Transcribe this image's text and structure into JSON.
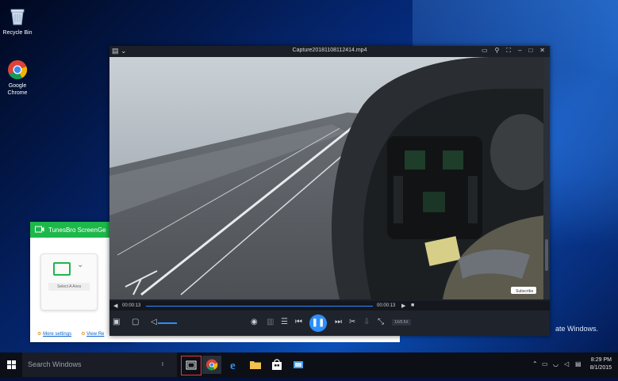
{
  "desktop": {
    "icons": [
      {
        "label": "Recycle Bin"
      },
      {
        "label": "Google Chrome"
      }
    ],
    "watermark": "ate Windows."
  },
  "recorder": {
    "title": "TunesBro ScreenGe",
    "select_area_label": "Select A Area",
    "more_settings": "More settings",
    "view_recordings": "View Re"
  },
  "player": {
    "filename": "Capture20181108112414.mp4",
    "time_current": "00:00:13",
    "time_total": "00:00:13",
    "progress": 1.0,
    "speed_label": "1X/0.5X",
    "watermark_text": "Subscribe",
    "accent": "#2b8fff"
  },
  "taskbar": {
    "search_placeholder": "Search Windows",
    "time": "8:29 PM",
    "date": "8/1/2015"
  }
}
